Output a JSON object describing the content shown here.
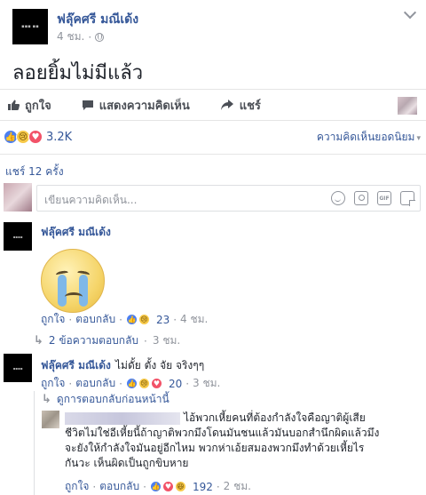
{
  "post": {
    "author": "ฟลุ๊คศรี มณีเด้ง",
    "time": "4 ชม.",
    "separator": "·",
    "text": "ลอยยิ้มไม่มีแล้ว"
  },
  "actions": {
    "like": "ถูกใจ",
    "comment": "แสดงความคิดเห็น",
    "share": "แชร์"
  },
  "reactions": {
    "count": "3.2K",
    "sort": "ความคิดเห็นยอดนิยม"
  },
  "shares": "แชร์ 12 ครั้ง",
  "composer": {
    "placeholder": "เขียนความคิดเห็น..."
  },
  "comments": [
    {
      "author": "ฟลุ๊คศรี มณีเด้ง",
      "text": "",
      "like": "ถูกใจ",
      "reply": "ตอบกลับ",
      "reaction_count": "23",
      "time": "4 ชม.",
      "replies_link": "2 ข้อความตอบกลับ",
      "replies_time": "3 ชม."
    },
    {
      "author": "ฟลุ๊คศรี มณีเด้ง",
      "text": "ไม่ดั้ย ตั้ง จัย จริงๆๆ",
      "like": "ถูกใจ",
      "reply": "ตอบกลับ",
      "reaction_count": "20",
      "time": "3 ชม.",
      "previous_replies": "ดูการตอบกลับก่อนหน้านี้",
      "nested": {
        "text_line1": "ไอ้พวกเหี้ยคนที่ต้องกำลังใจคือญาติผู้เสีย",
        "text_line2": "ชีวิตไม่ใช่อีเหี้ยนี้ถ้าญาติพวกมึงโดนมันชนแล้วมันบอกสำนึกผิดแล้วมึง",
        "text_line3": "จะยังให้กำลังใจมันอยู่อีกไหม พวกห่าเอ้ยสมองพวกมึงทำด้วยเหี้ยไร",
        "text_line4": "กันวะ เห็นผิดเป็นถูกขิบหาย",
        "like": "ถูกใจ",
        "reply": "ตอบกลับ",
        "reaction_count": "192",
        "time": "2 ชม."
      }
    }
  ],
  "colors": {
    "link": "#365899",
    "muted": "#90949c",
    "like_reaction": "#4c7ff0",
    "love_reaction": "#f25268",
    "sad_reaction": "#f7c948"
  }
}
